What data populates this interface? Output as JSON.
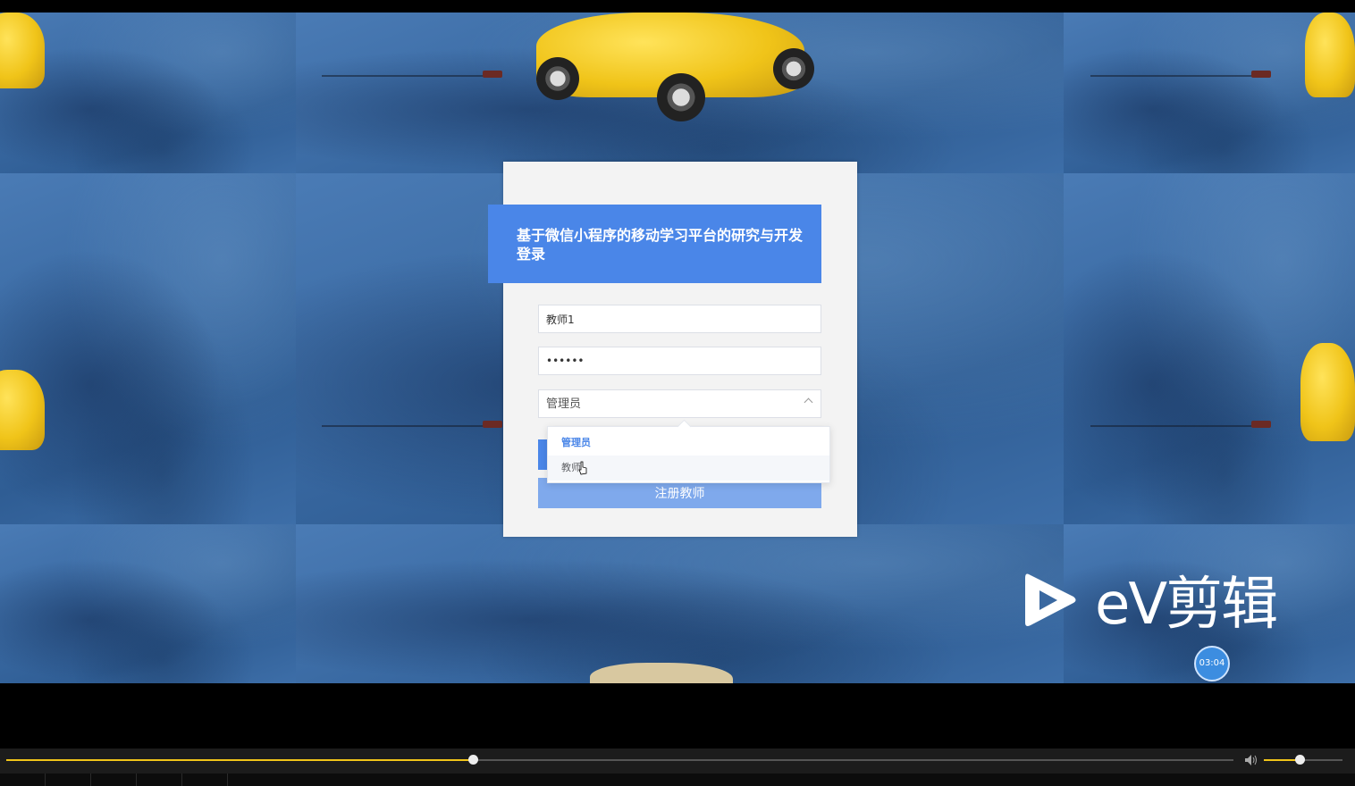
{
  "login": {
    "title": "基于微信小程序的移动学习平台的研究与开发登录",
    "username_value": "教师1",
    "password_value": "••••••",
    "role_selected": "管理员",
    "register_label": "注册教师"
  },
  "role_dropdown": {
    "options": [
      "管理员",
      "教师"
    ]
  },
  "watermark": {
    "brand": "eV剪辑",
    "time": "03:04"
  },
  "player": {
    "progress": 0.38,
    "volume": 0.45
  },
  "colors": {
    "primary": "#4a86e8",
    "register": "#7fa9ec",
    "seek": "#f0c419"
  }
}
